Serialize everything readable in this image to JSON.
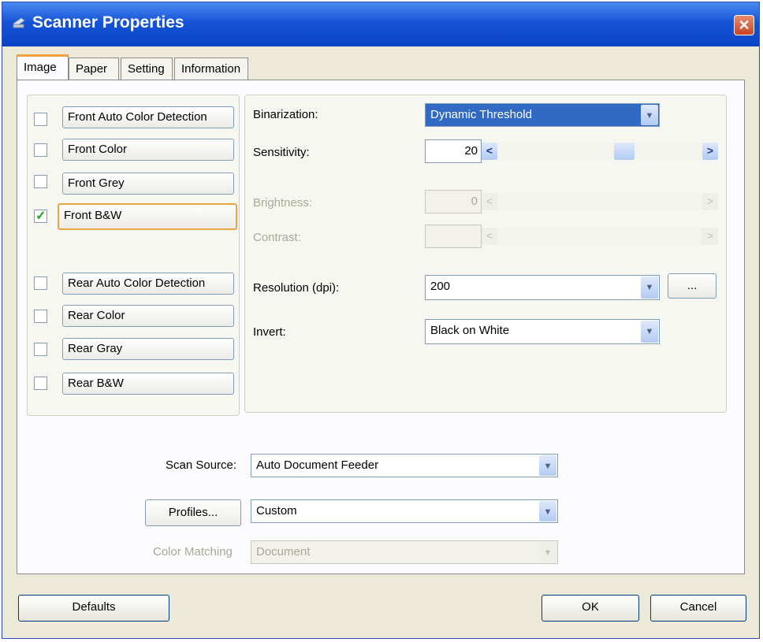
{
  "window": {
    "title": "Scanner Properties"
  },
  "tabs": [
    "Image",
    "Paper",
    "Setting",
    "Information"
  ],
  "image_types": {
    "front": [
      {
        "label": "Front Auto Color Detection",
        "checked": false
      },
      {
        "label": "Front Color",
        "checked": false
      },
      {
        "label": "Front Grey",
        "checked": false
      },
      {
        "label": "Front B&W",
        "checked": true
      }
    ],
    "rear": [
      {
        "label": "Rear Auto Color Detection",
        "checked": false
      },
      {
        "label": "Rear Color",
        "checked": false
      },
      {
        "label": "Rear Gray",
        "checked": false
      },
      {
        "label": "Rear B&W",
        "checked": false
      }
    ]
  },
  "settings": {
    "binarization_label": "Binarization:",
    "binarization_value": "Dynamic Threshold",
    "sensitivity_label": "Sensitivity:",
    "sensitivity_value": "20",
    "brightness_label": "Brightness:",
    "brightness_value": "0",
    "contrast_label": "Contrast:",
    "contrast_value": "",
    "resolution_label": "Resolution (dpi):",
    "resolution_value": "200",
    "resolution_more": "...",
    "invert_label": "Invert:",
    "invert_value": "Black on White"
  },
  "scan": {
    "source_label": "Scan Source:",
    "source_value": "Auto Document Feeder",
    "profiles_button": "Profiles...",
    "profiles_value": "Custom",
    "color_matching_label": "Color Matching",
    "color_matching_value": "Document"
  },
  "buttons": {
    "defaults": "Defaults",
    "ok": "OK",
    "cancel": "Cancel"
  }
}
